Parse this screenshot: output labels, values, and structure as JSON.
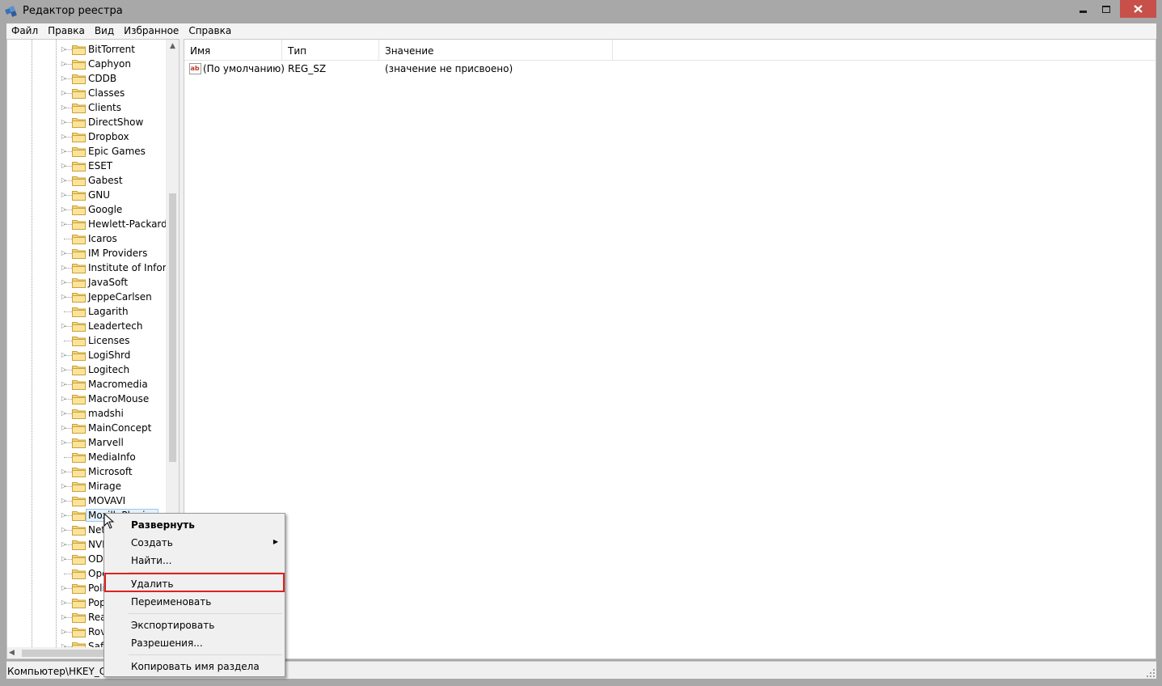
{
  "window": {
    "title": "Редактор реестра",
    "close_color": "#c7504b"
  },
  "menu": [
    "Файл",
    "Правка",
    "Вид",
    "Избранное",
    "Справка"
  ],
  "tree": {
    "items": [
      {
        "label": "BitTorrent",
        "expandable": true
      },
      {
        "label": "Caphyon",
        "expandable": true
      },
      {
        "label": "CDDB",
        "expandable": true
      },
      {
        "label": "Classes",
        "expandable": true
      },
      {
        "label": "Clients",
        "expandable": true
      },
      {
        "label": "DirectShow",
        "expandable": true
      },
      {
        "label": "Dropbox",
        "expandable": true
      },
      {
        "label": "Epic Games",
        "expandable": true
      },
      {
        "label": "ESET",
        "expandable": true
      },
      {
        "label": "Gabest",
        "expandable": true
      },
      {
        "label": "GNU",
        "expandable": true
      },
      {
        "label": "Google",
        "expandable": true
      },
      {
        "label": "Hewlett-Packard",
        "expandable": true
      },
      {
        "label": "Icaros",
        "expandable": false
      },
      {
        "label": "IM Providers",
        "expandable": true
      },
      {
        "label": "Institute of Inform",
        "expandable": true
      },
      {
        "label": "JavaSoft",
        "expandable": true
      },
      {
        "label": "JeppeCarlsen",
        "expandable": true
      },
      {
        "label": "Lagarith",
        "expandable": false
      },
      {
        "label": "Leadertech",
        "expandable": true
      },
      {
        "label": "Licenses",
        "expandable": false
      },
      {
        "label": "LogiShrd",
        "expandable": true
      },
      {
        "label": "Logitech",
        "expandable": true
      },
      {
        "label": "Macromedia",
        "expandable": true
      },
      {
        "label": "MacroMouse",
        "expandable": true
      },
      {
        "label": "madshi",
        "expandable": true
      },
      {
        "label": "MainConcept",
        "expandable": true
      },
      {
        "label": "Marvell",
        "expandable": true
      },
      {
        "label": "MediaInfo",
        "expandable": false
      },
      {
        "label": "Microsoft",
        "expandable": true
      },
      {
        "label": "Mirage",
        "expandable": true
      },
      {
        "label": "MOVAVI",
        "expandable": true
      },
      {
        "label": "MozillaPlugins",
        "expandable": true,
        "selected": true
      },
      {
        "label": "Netscape",
        "expandable": true
      },
      {
        "label": "NVIDIA Corporation",
        "expandable": true
      },
      {
        "label": "ODBC",
        "expandable": true
      },
      {
        "label": "Opera Software",
        "expandable": false
      },
      {
        "label": "Policies",
        "expandable": true
      },
      {
        "label": "PopCap",
        "expandable": true
      },
      {
        "label": "RealNetworks",
        "expandable": true
      },
      {
        "label": "Rovi",
        "expandable": true
      },
      {
        "label": "Safer",
        "expandable": true
      }
    ]
  },
  "values": {
    "columns": [
      "Имя",
      "Тип",
      "Значение"
    ],
    "rows": [
      {
        "name": "(По умолчанию)",
        "type": "REG_SZ",
        "data": "(значение не присвоено)"
      }
    ]
  },
  "status": "Компьютер\\HKEY_CU",
  "context_menu": {
    "items": [
      {
        "label": "Развернуть",
        "bold": true
      },
      {
        "label": "Создать",
        "submenu": true
      },
      {
        "label": "Найти..."
      },
      {
        "label": "Удалить",
        "highlighted": true
      },
      {
        "label": "Переименовать"
      },
      {
        "label": "Экспортировать"
      },
      {
        "label": "Разрешения..."
      },
      {
        "label": "Копировать имя раздела"
      }
    ],
    "highlight_color": "#e0201e"
  }
}
